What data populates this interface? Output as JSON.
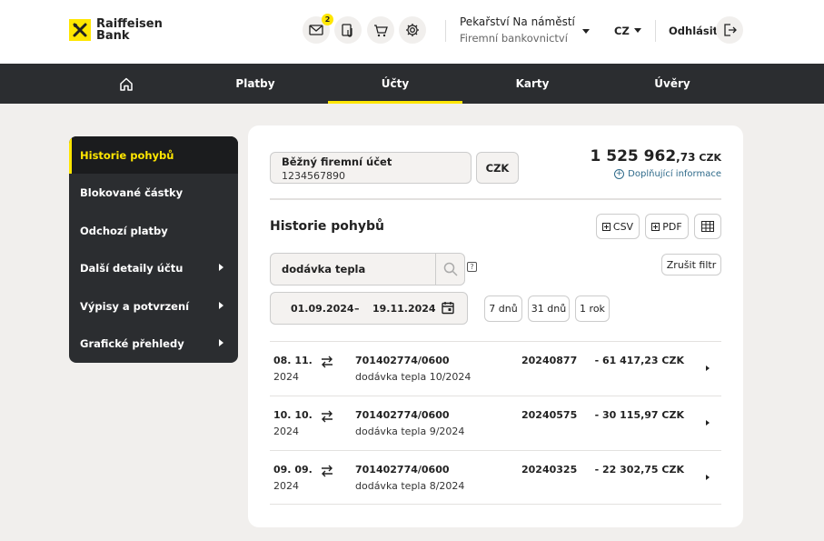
{
  "header": {
    "logo_line1": "Raiffeisen",
    "logo_line2": "Bank",
    "messages_badge": "2",
    "company_name": "Pekařství Na náměstí",
    "company_sub": "Firemní bankovnictví",
    "language": "CZ",
    "logout_label": "Odhlásit"
  },
  "nav": {
    "items": [
      {
        "label": "Platby"
      },
      {
        "label": "Účty"
      },
      {
        "label": "Karty"
      },
      {
        "label": "Úvěry"
      }
    ]
  },
  "sidebar": {
    "items": [
      {
        "label": "Historie pohybů"
      },
      {
        "label": "Blokované částky"
      },
      {
        "label": "Odchozí platby"
      },
      {
        "label": "Další detaily účtu"
      },
      {
        "label": "Výpisy a potvrzení"
      },
      {
        "label": "Grafické přehledy"
      }
    ]
  },
  "account": {
    "name": "Běžný firemní účet",
    "number": "1234567890",
    "currency_button": "CZK",
    "balance_main": "1 525 962",
    "balance_dec": ",73",
    "balance_ccy": "CZK",
    "more_info": "Doplňující informace"
  },
  "history": {
    "title": "Historie pohybů",
    "csv_label": "CSV",
    "pdf_label": "PDF",
    "search_value": "dodávka tepla",
    "clear_filter": "Zrušit filtr",
    "date_from": "01.09.2024",
    "date_dash": "–",
    "date_to": "19.11.2024",
    "ranges": [
      "7 dnů",
      "31 dnů",
      "1 rok"
    ],
    "rows": [
      {
        "date1": "08. 11.",
        "date2": "2024",
        "account": "701402774/0600",
        "desc": "dodávka tepla 10/2024",
        "ref": "20240877",
        "amount": "- 61 417,23 CZK"
      },
      {
        "date1": "10. 10.",
        "date2": "2024",
        "account": "701402774/0600",
        "desc": "dodávka tepla 9/2024",
        "ref": "20240575",
        "amount": "- 30 115,97 CZK"
      },
      {
        "date1": "09. 09.",
        "date2": "2024",
        "account": "701402774/0600",
        "desc": "dodávka tepla 8/2024",
        "ref": "20240325",
        "amount": "- 22 302,75 CZK"
      }
    ]
  },
  "colors": {
    "brand_yellow": "#ffe600",
    "nav_dark": "#2b2d30",
    "link_blue": "#2e6a8a"
  }
}
